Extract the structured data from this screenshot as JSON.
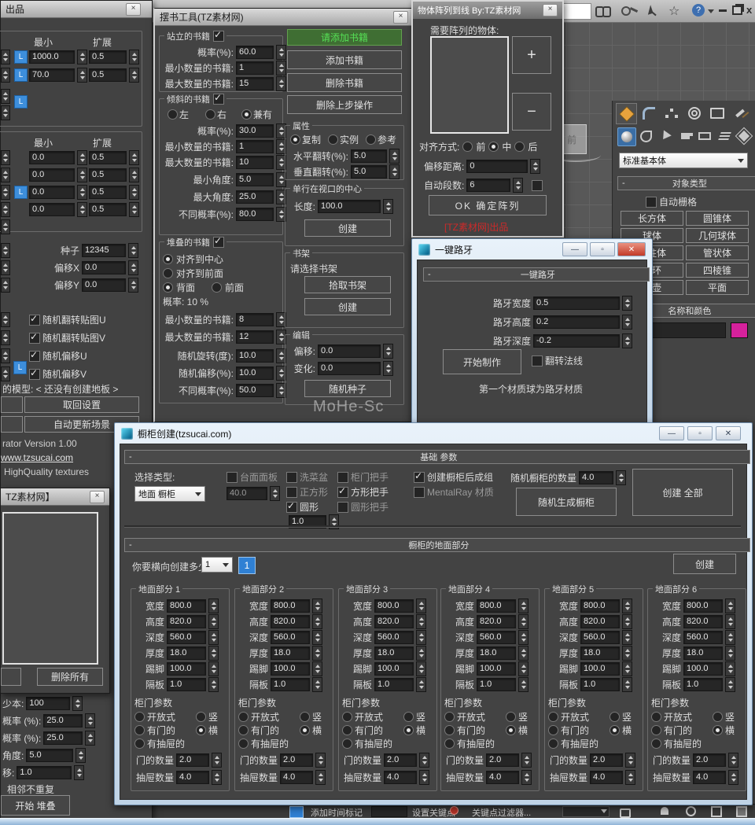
{
  "main": {
    "title_icons": [
      "binoculars-icon",
      "key-icon",
      "satellite-icon",
      "star-icon",
      "help-icon"
    ],
    "window_controls": [
      "minimize",
      "restore",
      "close"
    ]
  },
  "watermark": "MoHe-Sc",
  "viewcube": {
    "front": "前"
  },
  "left_panel": {
    "title": "出品",
    "close": "×",
    "l_label": "L",
    "sec1": {
      "col_min": "最小",
      "col_exp": "扩展",
      "rows": [
        {
          "v": "1000.0",
          "e": "0.5"
        },
        {
          "v": "70.0",
          "e": "0.5"
        }
      ]
    },
    "sec2": {
      "col_min": "最小",
      "col_exp": "扩展",
      "rows": [
        {
          "v": "0.0",
          "e": "0.5"
        },
        {
          "v": "0.0",
          "e": "0.5"
        },
        {
          "v": "0.0",
          "e": "0.5"
        },
        {
          "v": "0.0",
          "e": "0.5"
        }
      ]
    },
    "seed_label": "种子",
    "seed": "12345",
    "offx_label": "偏移X",
    "offx": "0.0",
    "offy_label": "偏移Y",
    "offy": "0.0",
    "checks": {
      "c1": "随机翻转贴图U",
      "c2": "随机翻转贴图V",
      "c3": "随机偏移U",
      "c4": "随机偏移V"
    },
    "model_note": "的模型: < 还没有创建地板 >",
    "btn_restore": "取回设置",
    "btn_autoupdate": "自动更新场景",
    "version_text": "rator Version 1.00",
    "site": "www.tzsucai.com",
    "quality": "HighQuality textures",
    "sub_title": "TZ素材网】",
    "btn_delete_all": "删除所有",
    "fields": {
      "f1l": "少本:",
      "f1v": "100",
      "f2l": "概率 (%):",
      "f2v": "25.0",
      "f3l": "概率 (%):",
      "f3v": "25.0",
      "f4l": "角度:",
      "f4v": "5.0",
      "f5l": "移:",
      "f5v": "1.0"
    },
    "adjacent": "相邻不重复",
    "btn_start_stack": "开始 堆叠"
  },
  "book_tool": {
    "title": "摆书工具(TZ素材网)",
    "standing": {
      "title": "站立的书籍",
      "prob_label": "概率(%):",
      "prob": "60.0",
      "min_label": "最小数量的书籍:",
      "min": "1",
      "max_label": "最大数量的书籍:",
      "max": "15"
    },
    "tilted": {
      "title": "倾斜的书籍",
      "left": "左",
      "right": "右",
      "both": "兼有",
      "prob_label": "概率(%):",
      "prob": "30.0",
      "min_label": "最小数量的书籍:",
      "min": "1",
      "max_label": "最大数量的书籍:",
      "max": "10",
      "min_angle_label": "最小角度:",
      "min_angle": "5.0",
      "max_angle_label": "最大角度:",
      "max_angle": "25.0",
      "diff_label": "不同概率(%):",
      "diff": "80.0"
    },
    "stacked": {
      "title": "堆叠的书籍",
      "align_center": "对齐到中心",
      "align_front": "对齐到前面",
      "back": "背面",
      "front": "前面",
      "prob_text": "概率: 10 %",
      "min_label": "最小数量的书籍:",
      "min": "8",
      "max_label": "最大数量的书籍:",
      "max": "12",
      "rot_label": "随机旋转(度):",
      "rot": "10.0",
      "off_label": "随机偏移(%):",
      "off": "10.0",
      "diff_label": "不同概率(%):",
      "diff": "50.0"
    },
    "add_hint": "请添加书籍",
    "add": "添加书籍",
    "remove": "删除书籍",
    "undo": "删除上步操作",
    "props": {
      "title": "属性",
      "copy": "复制",
      "instance": "实例",
      "reference": "参考",
      "hflip_label": "水平翻转(%):",
      "hflip": "5.0",
      "vflip_label": "垂直翻转(%):",
      "vflip": "5.0"
    },
    "center_row": {
      "title": "单行在视口的中心",
      "len_label": "长度:",
      "len": "100.0",
      "create": "创建"
    },
    "shelf": {
      "title": "书架",
      "hint": "请选择书架",
      "pick": "拾取书架",
      "create": "创建"
    },
    "edit": {
      "title": "编辑",
      "off_label": "偏移:",
      "off": "0.0",
      "vary_label": "变化:",
      "vary": "0.0",
      "seed": "随机种子"
    }
  },
  "array_tool": {
    "title": "物体阵列到线 By:TZ素材网",
    "close": "×",
    "objects_label": "需要阵列的物体:",
    "plus": "+",
    "minus": "−",
    "align_label": "对齐方式:",
    "opt_front": "前",
    "opt_mid": "中",
    "opt_back": "后",
    "offset_label": "偏移距离:",
    "offset": "0",
    "segs_label": "自动段数:",
    "segs": "6",
    "ok": "OK 确定阵列",
    "credit": "[TZ素材网]出品"
  },
  "curb_tool": {
    "title": "一键路牙",
    "rollout": "一键路牙",
    "width_label": "路牙宽度",
    "width": "0.5",
    "height_label": "路牙高度",
    "height": "0.2",
    "depth_label": "路牙深度",
    "depth": "-0.2",
    "start": "开始制作",
    "flip": "翻转法线",
    "note": "第一个材质球为路牙材质"
  },
  "command_panel": {
    "tabs": [
      "create",
      "modify",
      "hierarchy",
      "motion",
      "display",
      "utilities"
    ],
    "categories": [
      "geometry",
      "shapes",
      "lights",
      "cameras",
      "helpers",
      "space-warps",
      "systems"
    ],
    "dropdown": "标准基本体",
    "rollout_object_type": "对象类型",
    "autogrid": "自动栅格",
    "buttons": {
      "b1": "长方体",
      "b2": "圆锥体",
      "b3": "球体",
      "b4": "几何球体",
      "b5": "圆柱体",
      "b6": "管状体",
      "b7": "圆环",
      "b8": "四棱锥",
      "b9": "茶壶",
      "b10": "平面"
    },
    "rollout_name_color": "名称和颜色",
    "swatch_color": "#d6219c"
  },
  "cabinet_tool": {
    "title": "橱柜创建(tzsucai.com)",
    "rollout_basic": "基础 参数",
    "select_type_label": "选择类型:",
    "select_type_value": "地面 橱柜",
    "counter_panel": "台面面板",
    "counter_value": "40.0",
    "sink": "洗菜盆",
    "square": "正方形",
    "round": "圆形",
    "round_value": "1.0",
    "handle": "柜门把手",
    "square_handle": "方形把手",
    "round_handle": "圆形把手",
    "group_after": "创建橱柜后成组",
    "mentalray": "MentalRay 材质",
    "random_count_label": "随机橱柜的数量",
    "random_count": "4.0",
    "random_generate": "随机生成橱柜",
    "create_all": "创建 全部",
    "rollout_floor": "橱柜的地面部分",
    "how_many_label": "你要横向创建多少",
    "how_many_value": "1",
    "tab_label": "1",
    "create": "创建",
    "sections": [
      {
        "title": "地面部分 1",
        "fields": [
          {
            "l": "宽度",
            "v": "800.0"
          },
          {
            "l": "高度",
            "v": "820.0"
          },
          {
            "l": "深度",
            "v": "560.0"
          },
          {
            "l": "厚度",
            "v": "18.0"
          },
          {
            "l": "踢脚",
            "v": "100.0"
          },
          {
            "l": "隔板",
            "v": "1.0"
          }
        ],
        "door_title": "柜门参数",
        "r_open": "开放式",
        "r_door": "有门的",
        "r_drawer": "有抽屉的",
        "r_v": "竖",
        "r_h": "横",
        "doors_l": "门的数量",
        "doors_v": "2.0",
        "drawers_l": "抽屉数量",
        "drawers_v": "4.0"
      },
      {
        "title": "地面部分 2",
        "fields": [
          {
            "l": "宽度",
            "v": "800.0"
          },
          {
            "l": "高度",
            "v": "820.0"
          },
          {
            "l": "深度",
            "v": "560.0"
          },
          {
            "l": "厚度",
            "v": "18.0"
          },
          {
            "l": "踢脚",
            "v": "100.0"
          },
          {
            "l": "隔板",
            "v": "1.0"
          }
        ],
        "door_title": "柜门参数",
        "r_open": "开放式",
        "r_door": "有门的",
        "r_drawer": "有抽屉的",
        "r_v": "竖",
        "r_h": "横",
        "doors_l": "门的数量",
        "doors_v": "2.0",
        "drawers_l": "抽屉数量",
        "drawers_v": "4.0"
      },
      {
        "title": "地面部分 3",
        "fields": [
          {
            "l": "宽度",
            "v": "800.0"
          },
          {
            "l": "高度",
            "v": "820.0"
          },
          {
            "l": "深度",
            "v": "560.0"
          },
          {
            "l": "厚度",
            "v": "18.0"
          },
          {
            "l": "踢脚",
            "v": "100.0"
          },
          {
            "l": "隔板",
            "v": "1.0"
          }
        ],
        "door_title": "柜门参数",
        "r_open": "开放式",
        "r_door": "有门的",
        "r_drawer": "有抽屉的",
        "r_v": "竖",
        "r_h": "横",
        "doors_l": "门的数量",
        "doors_v": "2.0",
        "drawers_l": "抽屉数量",
        "drawers_v": "4.0"
      },
      {
        "title": "地面部分 4",
        "fields": [
          {
            "l": "宽度",
            "v": "800.0"
          },
          {
            "l": "高度",
            "v": "820.0"
          },
          {
            "l": "深度",
            "v": "560.0"
          },
          {
            "l": "厚度",
            "v": "18.0"
          },
          {
            "l": "踢脚",
            "v": "100.0"
          },
          {
            "l": "隔板",
            "v": "1.0"
          }
        ],
        "door_title": "柜门参数",
        "r_open": "开放式",
        "r_door": "有门的",
        "r_drawer": "有抽屉的",
        "r_v": "竖",
        "r_h": "横",
        "doors_l": "门的数量",
        "doors_v": "2.0",
        "drawers_l": "抽屉数量",
        "drawers_v": "4.0"
      },
      {
        "title": "地面部分 5",
        "fields": [
          {
            "l": "宽度",
            "v": "800.0"
          },
          {
            "l": "高度",
            "v": "820.0"
          },
          {
            "l": "深度",
            "v": "560.0"
          },
          {
            "l": "厚度",
            "v": "18.0"
          },
          {
            "l": "踢脚",
            "v": "100.0"
          },
          {
            "l": "隔板",
            "v": "1.0"
          }
        ],
        "door_title": "柜门参数",
        "r_open": "开放式",
        "r_door": "有门的",
        "r_drawer": "有抽屉的",
        "r_v": "竖",
        "r_h": "横",
        "doors_l": "门的数量",
        "doors_v": "2.0",
        "drawers_l": "抽屉数量",
        "drawers_v": "4.0"
      },
      {
        "title": "地面部分 6",
        "fields": [
          {
            "l": "宽度",
            "v": "800.0"
          },
          {
            "l": "高度",
            "v": "820.0"
          },
          {
            "l": "深度",
            "v": "560.0"
          },
          {
            "l": "厚度",
            "v": "18.0"
          },
          {
            "l": "踢脚",
            "v": "100.0"
          },
          {
            "l": "隔板",
            "v": "1.0"
          }
        ],
        "door_title": "柜门参数",
        "r_open": "开放式",
        "r_door": "有门的",
        "r_drawer": "有抽屉的",
        "r_v": "竖",
        "r_h": "横",
        "doors_l": "门的数量",
        "doors_v": "2.0",
        "drawers_l": "抽屉数量",
        "drawers_v": "4.0"
      }
    ]
  },
  "status_bar": {
    "add_time_tag": "添加时间标记",
    "set_key": "设置关键点",
    "key_filters": "关键点过滤器..."
  }
}
